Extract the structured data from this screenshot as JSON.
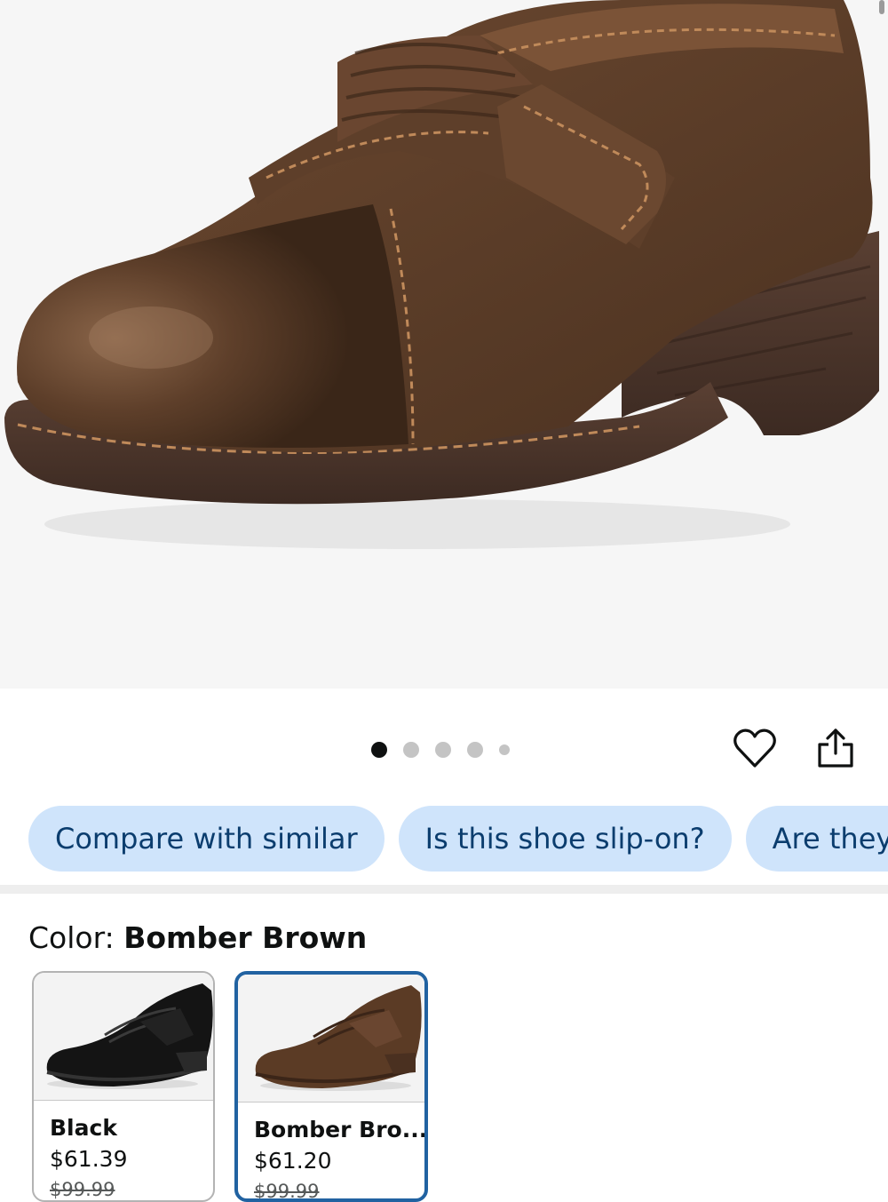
{
  "product": {
    "image_icon": "brown-leather-mary-jane-shoe-image",
    "carousel": {
      "count": 5,
      "active_index": 0
    }
  },
  "actions": {
    "favorite_icon": "heart-icon",
    "share_icon": "share-icon"
  },
  "questions": [
    {
      "label": "Compare with similar"
    },
    {
      "label": "Is this shoe slip-on?"
    },
    {
      "label": "Are they n"
    }
  ],
  "color": {
    "label": "Color:",
    "selected": "Bomber Brown",
    "options": [
      {
        "name": "Black",
        "price": "$61.39",
        "list_price": "$99.99",
        "selected": false,
        "swatch_color": "#1a1a1a"
      },
      {
        "name": "Bomber Bro...",
        "price": "$61.20",
        "list_price": "$99.99",
        "selected": true,
        "swatch_color": "#5b3b25"
      }
    ]
  },
  "colors": {
    "chip_bg": "#cfe4fb",
    "chip_text": "#0b3d6e",
    "selected_border": "#2162a1"
  }
}
